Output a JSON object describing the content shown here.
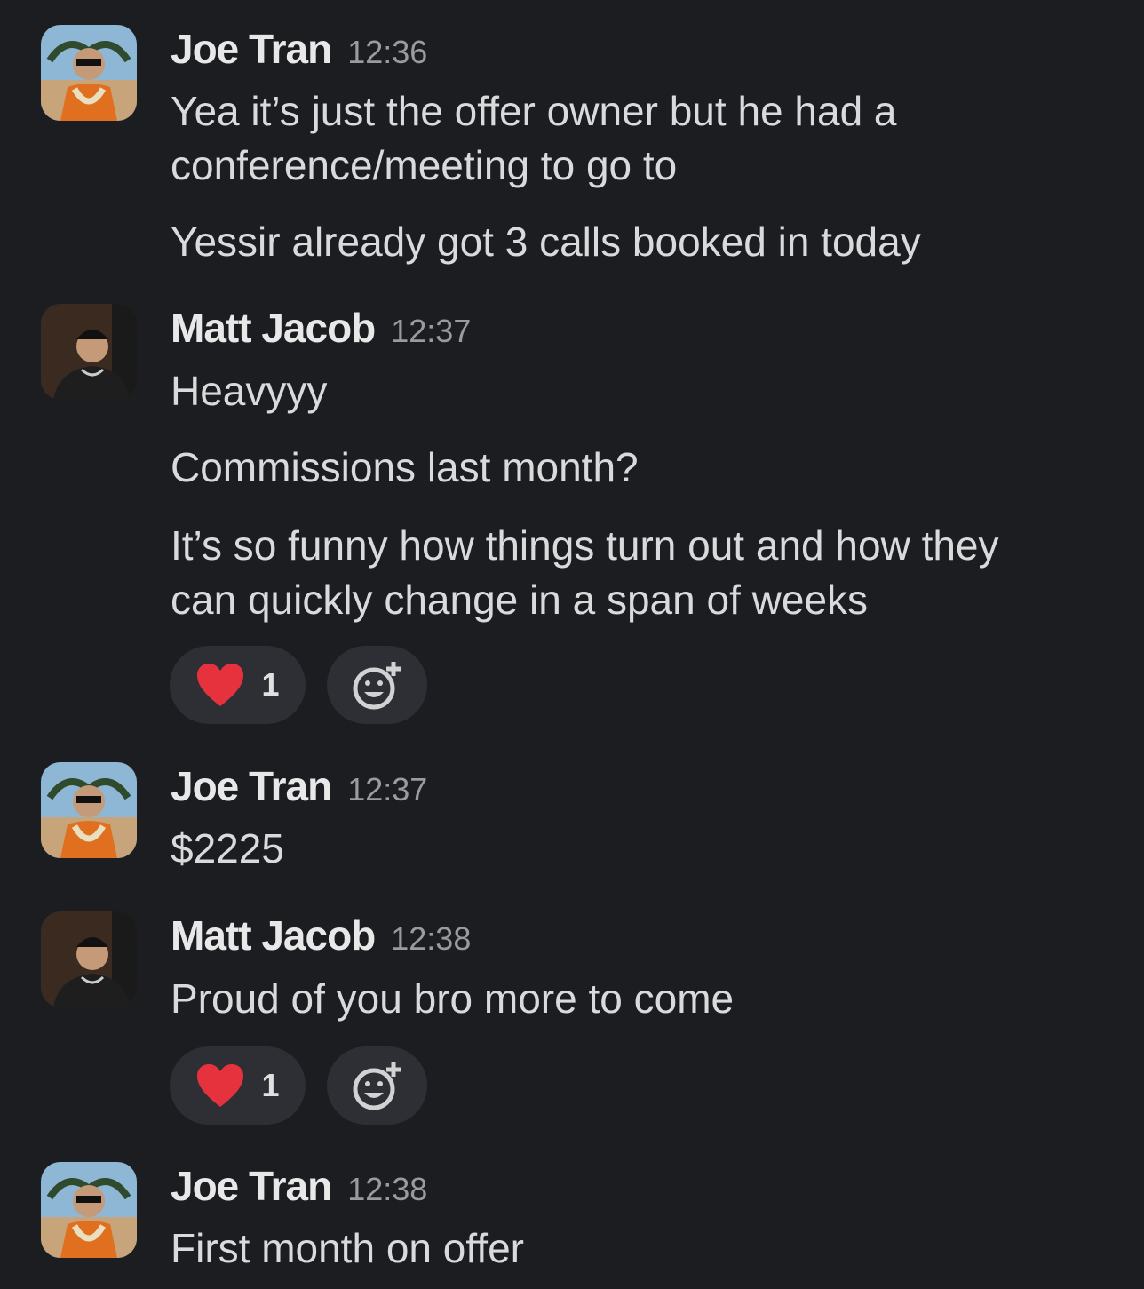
{
  "messages": [
    {
      "author": "Joe Tran",
      "time": "12:36",
      "lines": [
        "Yea it’s just the offer owner but he had a",
        "conference/meeting to go to",
        "Yessir already got 3 calls booked in today"
      ]
    },
    {
      "author": "Matt Jacob",
      "time": "12:37",
      "lines": [
        "Heavyyy",
        "Commissions last month?",
        "It’s so funny how things turn out and how they",
        "can quickly change in a span of weeks"
      ],
      "reaction": {
        "emoji": "heart-emoji",
        "count": "1"
      }
    },
    {
      "author": "Joe Tran",
      "time": "12:37",
      "lines": [
        "$2225"
      ]
    },
    {
      "author": "Matt Jacob",
      "time": "12:38",
      "lines": [
        "Proud of you bro more to come"
      ],
      "reaction": {
        "emoji": "heart-emoji",
        "count": "1"
      }
    },
    {
      "author": "Joe Tran",
      "time": "12:38",
      "lines": [
        "First month on offer"
      ]
    }
  ],
  "colors": {
    "background": "#1b1d21",
    "pill": "#2d2f34",
    "heart": "#e5323d",
    "timestamp": "#9a9b9e"
  }
}
